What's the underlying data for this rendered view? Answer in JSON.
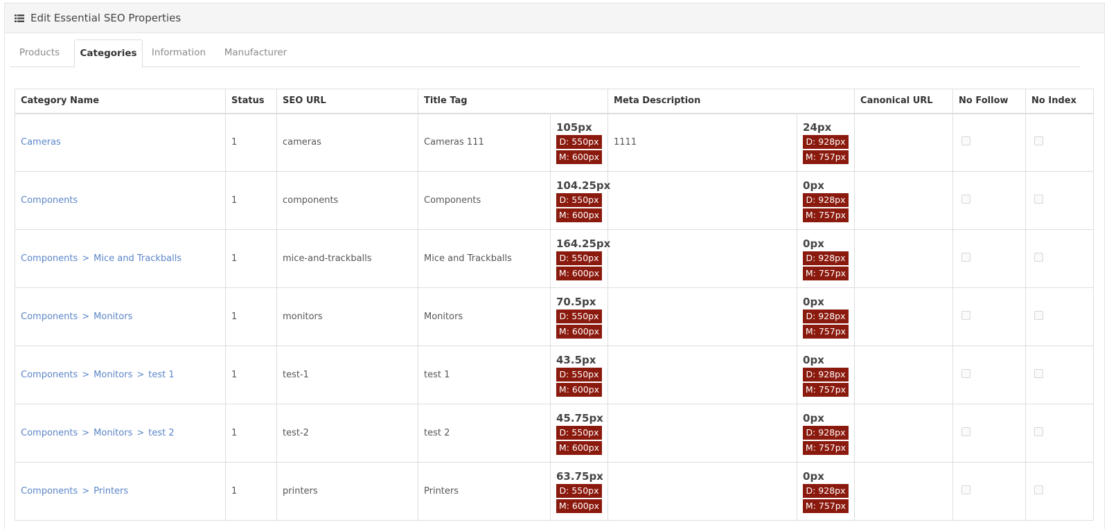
{
  "panel": {
    "title": "Edit Essential SEO Properties"
  },
  "tabs": [
    {
      "label": "Products",
      "active": false
    },
    {
      "label": "Categories",
      "active": true
    },
    {
      "label": "Information",
      "active": false
    },
    {
      "label": "Manufacturer",
      "active": false
    }
  ],
  "table": {
    "headers": {
      "category_name": "Category Name",
      "status": "Status",
      "seo_url": "SEO URL",
      "title_tag": "Title Tag",
      "meta_description": "Meta Description",
      "canonical_url": "Canonical URL",
      "no_follow": "No Follow",
      "no_index": "No Index"
    },
    "badge_labels": {
      "title_desktop": "D: 550px",
      "title_mobile": "M: 600px",
      "meta_desktop": "D: 928px",
      "meta_mobile": "M: 757px"
    },
    "rows": [
      {
        "crumbs": [
          "Cameras"
        ],
        "status": "1",
        "seo_url": "cameras",
        "title": "Cameras 111",
        "title_px": "105px",
        "meta": "1111",
        "meta_px": "24px"
      },
      {
        "crumbs": [
          "Components"
        ],
        "status": "1",
        "seo_url": "components",
        "title": "Components",
        "title_px": "104.25px",
        "meta": "",
        "meta_px": "0px"
      },
      {
        "crumbs": [
          "Components",
          "Mice and Trackballs"
        ],
        "status": "1",
        "seo_url": "mice-and-trackballs",
        "title": "Mice and Trackballs",
        "title_px": "164.25px",
        "meta": "",
        "meta_px": "0px"
      },
      {
        "crumbs": [
          "Components",
          "Monitors"
        ],
        "status": "1",
        "seo_url": "monitors",
        "title": "Monitors",
        "title_px": "70.5px",
        "meta": "",
        "meta_px": "0px"
      },
      {
        "crumbs": [
          "Components",
          "Monitors",
          "test 1"
        ],
        "status": "1",
        "seo_url": "test-1",
        "title": "test 1",
        "title_px": "43.5px",
        "meta": "",
        "meta_px": "0px"
      },
      {
        "crumbs": [
          "Components",
          "Monitors",
          "test 2"
        ],
        "status": "1",
        "seo_url": "test-2",
        "title": "test 2",
        "title_px": "45.75px",
        "meta": "",
        "meta_px": "0px"
      },
      {
        "crumbs": [
          "Components",
          "Printers"
        ],
        "status": "1",
        "seo_url": "printers",
        "title": "Printers",
        "title_px": "63.75px",
        "meta": "",
        "meta_px": "0px"
      }
    ]
  },
  "colors": {
    "link": "#5b85c8",
    "badge": "#8b1a0e"
  },
  "icons": {
    "heading": "list-icon"
  }
}
